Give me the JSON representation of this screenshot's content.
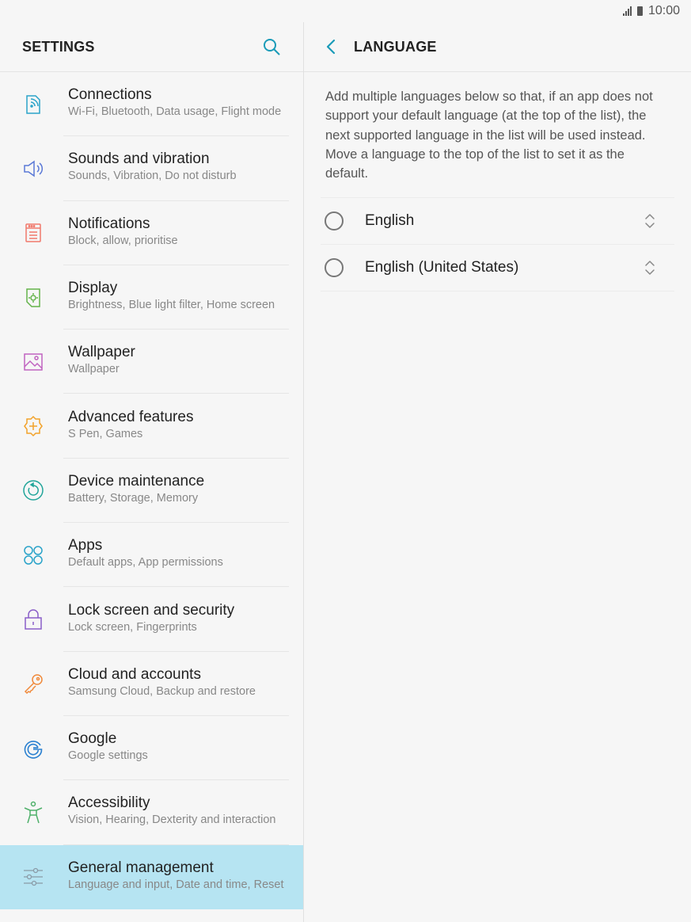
{
  "status": {
    "time": "10:00"
  },
  "left": {
    "title": "SETTINGS",
    "items": [
      {
        "title": "Connections",
        "subtitle": "Wi-Fi, Bluetooth, Data usage, Flight mode",
        "icon": "connections-icon",
        "color": "#2aa3c9"
      },
      {
        "title": "Sounds and vibration",
        "subtitle": "Sounds, Vibration, Do not disturb",
        "icon": "speaker-icon",
        "color": "#5a78d6"
      },
      {
        "title": "Notifications",
        "subtitle": "Block, allow, prioritise",
        "icon": "notifications-icon",
        "color": "#f0786b"
      },
      {
        "title": "Display",
        "subtitle": "Brightness, Blue light filter, Home screen",
        "icon": "display-icon",
        "color": "#63b34a"
      },
      {
        "title": "Wallpaper",
        "subtitle": "Wallpaper",
        "icon": "wallpaper-icon",
        "color": "#c064c0"
      },
      {
        "title": "Advanced features",
        "subtitle": "S Pen, Games",
        "icon": "advanced-features-icon",
        "color": "#f2a22a"
      },
      {
        "title": "Device maintenance",
        "subtitle": "Battery, Storage, Memory",
        "icon": "device-maintenance-icon",
        "color": "#22a59a"
      },
      {
        "title": "Apps",
        "subtitle": "Default apps, App permissions",
        "icon": "apps-icon",
        "color": "#2aa3c9"
      },
      {
        "title": "Lock screen and security",
        "subtitle": "Lock screen, Fingerprints",
        "icon": "lock-icon",
        "color": "#8a5fc8"
      },
      {
        "title": "Cloud and accounts",
        "subtitle": "Samsung Cloud, Backup and restore",
        "icon": "key-icon",
        "color": "#f08a3c"
      },
      {
        "title": "Google",
        "subtitle": "Google settings",
        "icon": "google-icon",
        "color": "#2a80d0"
      },
      {
        "title": "Accessibility",
        "subtitle": "Vision, Hearing, Dexterity and interaction",
        "icon": "accessibility-icon",
        "color": "#4fb06a"
      },
      {
        "title": "General management",
        "subtitle": "Language and input, Date and time, Reset",
        "icon": "general-management-icon",
        "color": "#8a9aa6",
        "active": true
      }
    ]
  },
  "right": {
    "title": "LANGUAGE",
    "description": "Add multiple languages below so that, if an app does not support your default language (at the top of the list), the next supported language in the list will be used instead. Move a language to the top of the list to set it as the default.",
    "languages": [
      "English",
      "English (United States)"
    ]
  },
  "colors": {
    "accent": "#1a9bb8",
    "active_row": "#b6e4f2"
  }
}
